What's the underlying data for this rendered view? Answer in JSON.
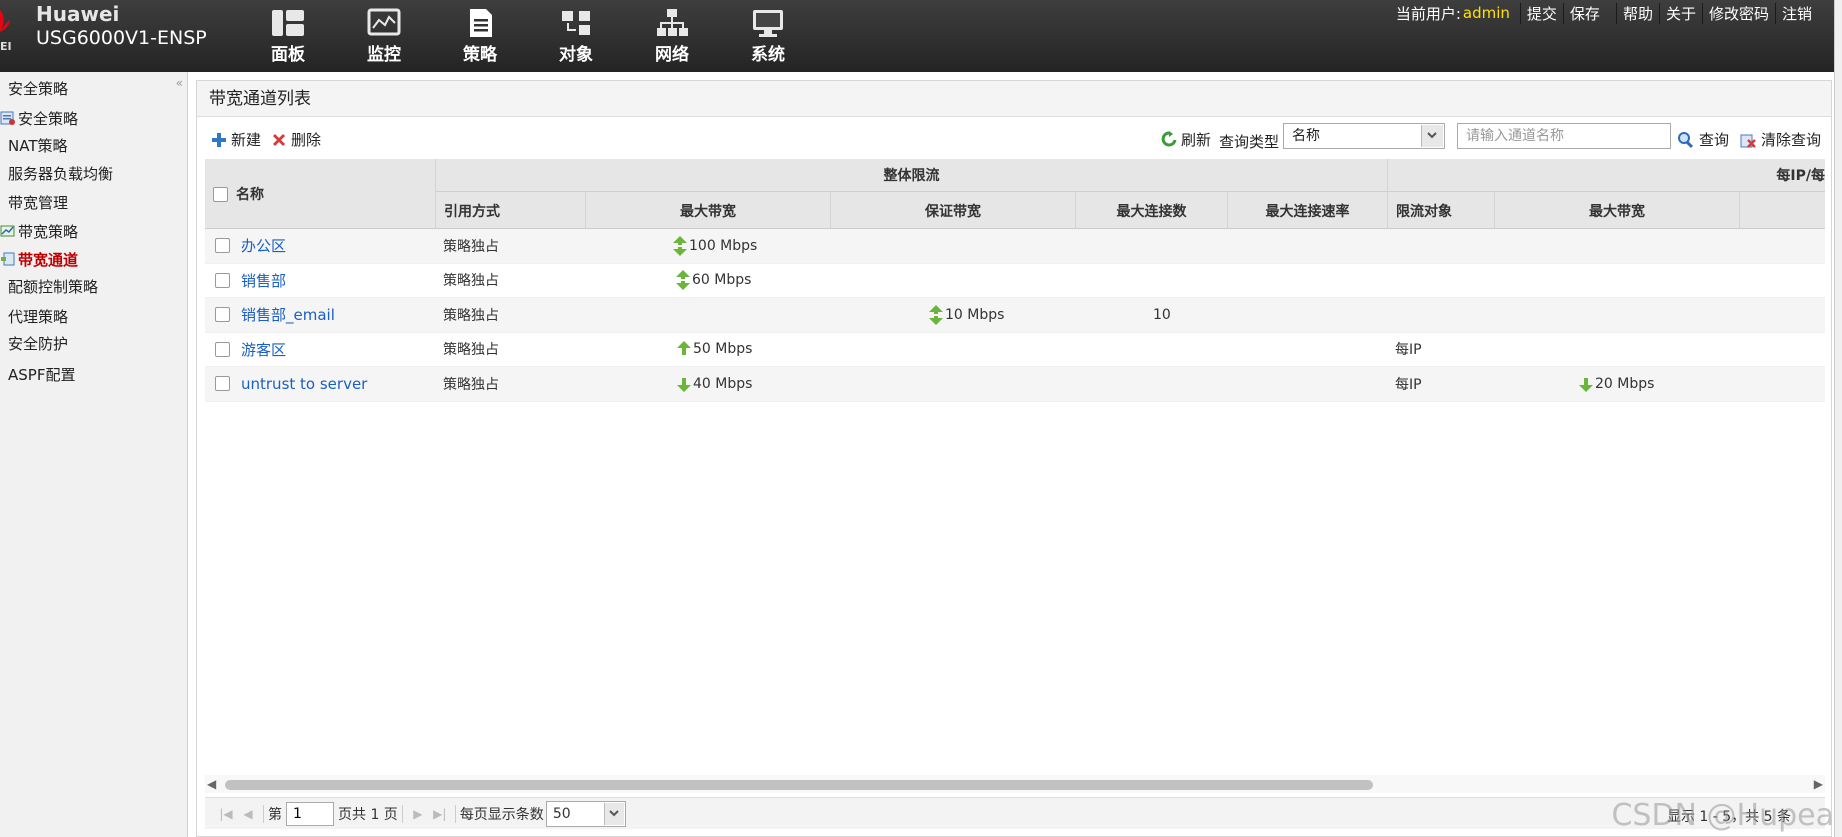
{
  "header": {
    "brand": "Huawei",
    "logo_sub": "EI",
    "model": "USG6000V1-ENSP",
    "nav": [
      {
        "label": "面板",
        "icon": "dashboard-icon"
      },
      {
        "label": "监控",
        "icon": "monitor-icon"
      },
      {
        "label": "策略",
        "icon": "policy-icon",
        "active": true
      },
      {
        "label": "对象",
        "icon": "object-icon"
      },
      {
        "label": "网络",
        "icon": "network-icon"
      },
      {
        "label": "系统",
        "icon": "system-icon"
      }
    ],
    "current_user_label": "当前用户:",
    "current_user": "admin",
    "links": {
      "submit": "提交",
      "save": "保存",
      "help": "帮助",
      "about": "关于",
      "change_password": "修改密码",
      "logout": "注销"
    }
  },
  "sidebar": {
    "collapse": "«",
    "items": [
      {
        "label": "安全策略"
      },
      {
        "label": "安全策略"
      },
      {
        "label": "NAT策略"
      },
      {
        "label": "服务器负载均衡"
      },
      {
        "label": "带宽管理"
      },
      {
        "label": "带宽策略"
      },
      {
        "label": "带宽通道",
        "active": true
      },
      {
        "label": "配额控制策略"
      },
      {
        "label": "代理策略"
      },
      {
        "label": "安全防护"
      },
      {
        "label": "ASPF配置"
      }
    ]
  },
  "panel": {
    "title": "带宽通道列表",
    "toolbar": {
      "new": "新建",
      "delete": "删除",
      "refresh": "刷新",
      "query_type_label": "查询类型",
      "query_type_value": "名称",
      "search_placeholder": "请输入通道名称",
      "query": "查询",
      "clear_query": "清除查询"
    }
  },
  "table": {
    "headers": {
      "name": "名称",
      "group_overall": "整体限流",
      "group_per_ip": "每IP/每",
      "ref_mode": "引用方式",
      "max_bw": "最大带宽",
      "guaranteed_bw": "保证带宽",
      "max_conn": "最大连接数",
      "max_conn_rate": "最大连接速率",
      "limit_target": "限流对象",
      "per_max_bw": "最大带宽"
    },
    "rows": [
      {
        "name": "办公区",
        "ref_mode": "策略独占",
        "max_bw": "100 Mbps",
        "max_bw_dir": "both",
        "guaranteed_bw": "",
        "max_conn": "",
        "limit_target": "",
        "per_max_bw": ""
      },
      {
        "name": "销售部",
        "ref_mode": "策略独占",
        "max_bw": "60 Mbps",
        "max_bw_dir": "both",
        "guaranteed_bw": "",
        "max_conn": "",
        "limit_target": "",
        "per_max_bw": ""
      },
      {
        "name": "销售部_email",
        "ref_mode": "策略独占",
        "max_bw": "",
        "guaranteed_bw": "10 Mbps",
        "gbw_dir": "both",
        "max_conn": "10",
        "limit_target": "",
        "per_max_bw": ""
      },
      {
        "name": "游客区",
        "ref_mode": "策略独占",
        "max_bw": "50 Mbps",
        "max_bw_dir": "up",
        "guaranteed_bw": "",
        "max_conn": "",
        "limit_target": "每IP",
        "per_max_bw": ""
      },
      {
        "name": "untrust to server",
        "ref_mode": "策略独占",
        "max_bw": "40 Mbps",
        "max_bw_dir": "down",
        "guaranteed_bw": "",
        "max_conn": "",
        "limit_target": "每IP",
        "per_max_bw": "20 Mbps",
        "per_dir": "down"
      }
    ]
  },
  "pager": {
    "page_prefix": "第",
    "page_value": "1",
    "page_suffix": "页共 1 页",
    "per_page_label": "每页显示条数",
    "per_page_value": "50",
    "summary": "显示 1 - 5，共 5 条"
  },
  "watermark": "CSDN @Hupea",
  "colors": {
    "accent_active": "#c00000",
    "link": "#1a5fc4",
    "user": "#ffe100",
    "arrow_up": "#6bb63a",
    "arrow_down": "#6bb63a"
  }
}
